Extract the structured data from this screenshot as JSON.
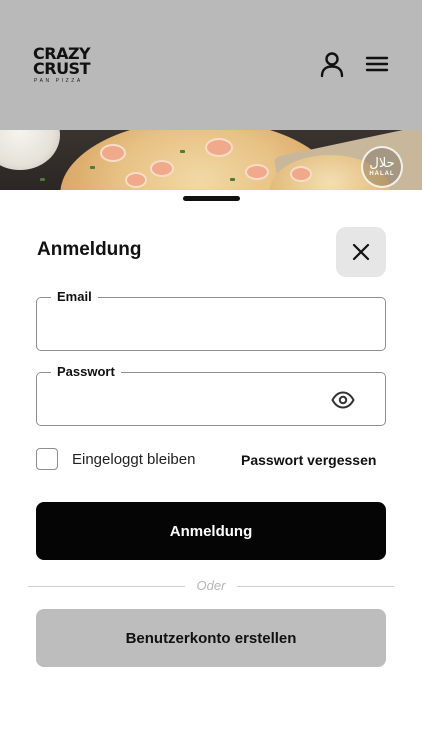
{
  "header": {
    "logo": {
      "line1": "CRAZY",
      "line2": "CRUST",
      "tagline": "PAN PIZZA"
    },
    "user_icon": "user-icon",
    "menu_icon": "hamburger-menu-icon",
    "background_color": "#b9b9b9"
  },
  "banner": {
    "badge": {
      "glyph": "حلال",
      "text": "HALAL"
    }
  },
  "login": {
    "title": "Anmeldung",
    "close_icon": "close-icon",
    "email": {
      "label": "Email",
      "value": "",
      "placeholder": ""
    },
    "password": {
      "label": "Passwort",
      "value": "",
      "placeholder": "",
      "toggle_icon": "eye-icon"
    },
    "remember_me": {
      "label": "Eingeloggt bleiben",
      "checked": false
    },
    "forgot_password": "Passwort vergessen",
    "submit_label": "Anmeldung",
    "divider_text": "Oder",
    "create_account_label": "Benutzerkonto erstellen"
  },
  "colors": {
    "primary_button": "#050505",
    "secondary_button": "#bdbdbd",
    "close_button_bg": "#e6e6e6"
  }
}
